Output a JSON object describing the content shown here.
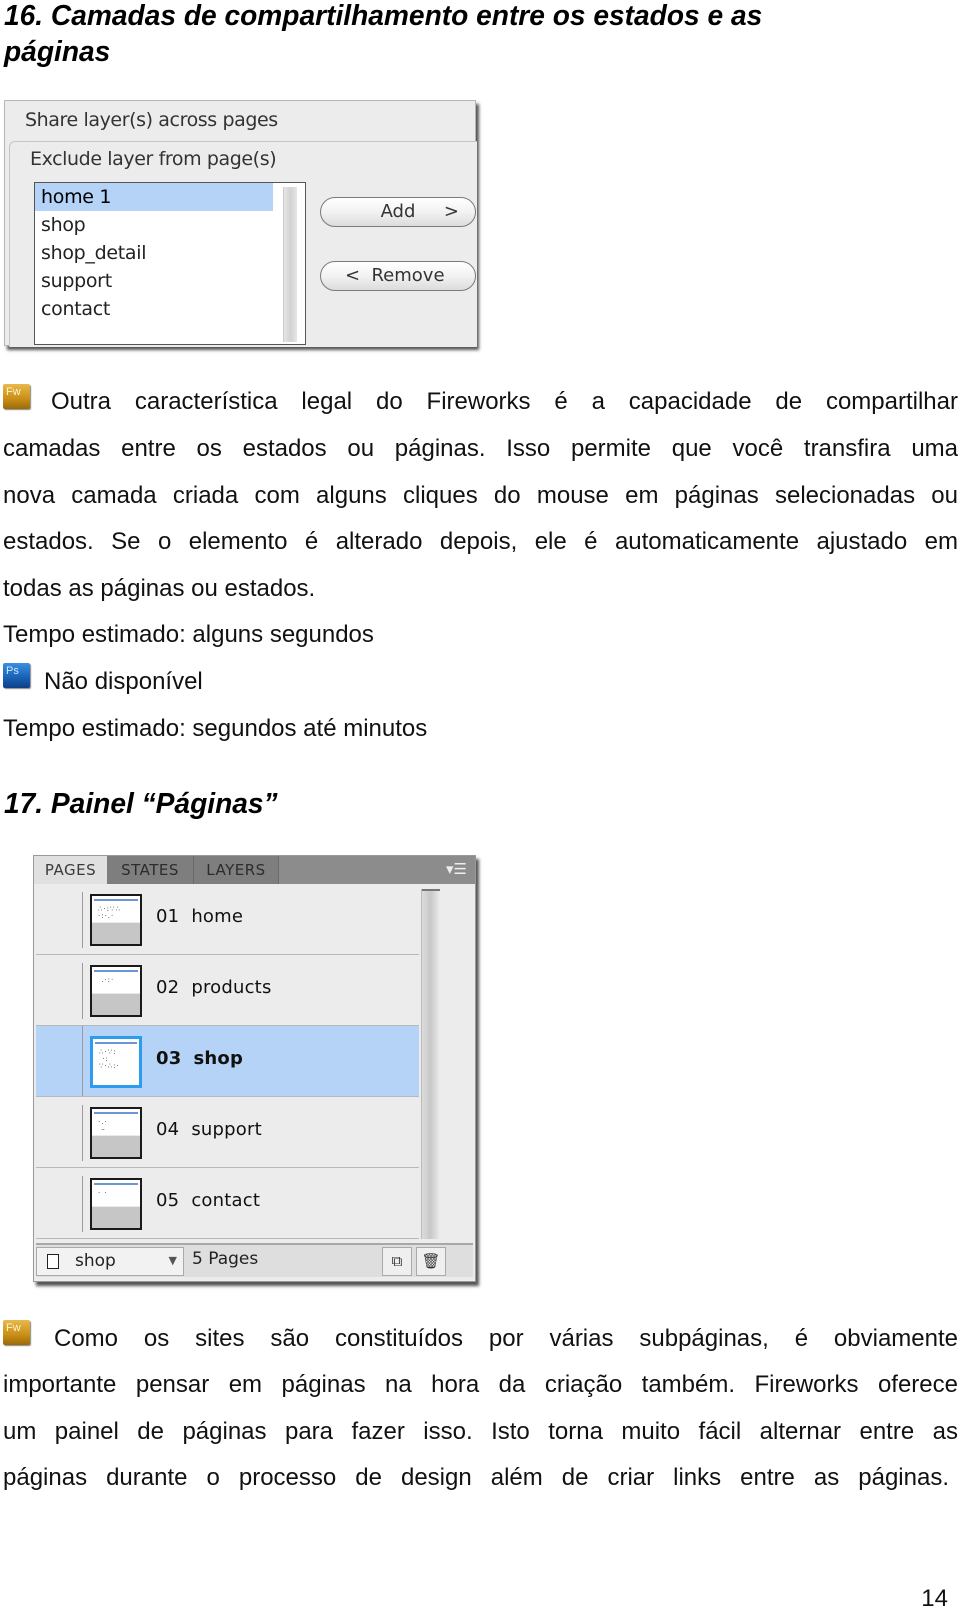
{
  "section16": {
    "heading_line1": "16. Camadas de compartilhamento entre os estados e as",
    "heading_line2": "páginas",
    "dialog": {
      "title": "Share layer(s) across pages",
      "subtitle": "Exclude layer from page(s)",
      "pages": [
        {
          "label": "home 1",
          "selected": true
        },
        {
          "label": "shop",
          "selected": false
        },
        {
          "label": "shop_detail",
          "selected": false
        },
        {
          "label": "support",
          "selected": false
        },
        {
          "label": "contact",
          "selected": false
        }
      ],
      "add_button": {
        "label": "Add",
        "arrow": ">"
      },
      "remove_button": {
        "label": "Remove",
        "arrow": "<"
      }
    },
    "fw_icon_label": "Fw",
    "paragraph_lines": [
      "Outra característica legal do Fireworks é a capacidade de compartilhar",
      "camadas entre os estados ou páginas.  Isso permite que você transfira uma",
      "nova camada criada com alguns cliques do mouse em páginas selecionadas ou",
      "estados. Se o elemento é alterado depois, ele é automaticamente ajustado em",
      "todas as páginas ou estados."
    ],
    "fw_time": "Tempo estimado: alguns segundos",
    "ps_icon_label": "Ps",
    "ps_note": "Não disponível",
    "ps_time": "Tempo estimado: segundos até minutos"
  },
  "section17": {
    "heading": "17. Painel “Páginas”",
    "panel": {
      "tabs": [
        {
          "label": "PAGES",
          "active": true
        },
        {
          "label": "STATES",
          "active": false
        },
        {
          "label": "LAYERS",
          "active": false
        }
      ],
      "menu_icon": "▾☰",
      "pages": [
        {
          "number": "01",
          "name": "home",
          "selected": false
        },
        {
          "number": "02",
          "name": "products",
          "selected": false
        },
        {
          "number": "03",
          "name": "shop",
          "selected": true
        },
        {
          "number": "04",
          "name": "support",
          "selected": false
        },
        {
          "number": "05",
          "name": "contact",
          "selected": false
        }
      ],
      "footer": {
        "current_page": "shop",
        "page_count": "5 Pages",
        "new_page_icon": "⧉",
        "delete_icon": "🗑"
      }
    },
    "fw_icon_label": "Fw",
    "paragraph_lines": [
      "Como os sites são constituídos por várias subpáginas, é obviamente",
      "importante pensar em páginas na hora da criação também. Fireworks oferece",
      "um painel de páginas para fazer isso. Isto torna muito fácil alternar entre as",
      "páginas durante o processo de design além de criar links entre as páginas."
    ]
  },
  "page_number": "14"
}
